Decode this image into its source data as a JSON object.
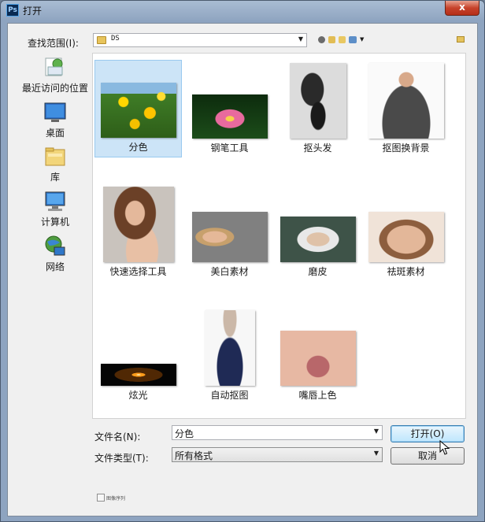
{
  "window": {
    "app_icon_text": "Ps",
    "title": "打开",
    "close_glyph": "x"
  },
  "lookin": {
    "label": "查找范围(I):",
    "value": "DS"
  },
  "places": [
    {
      "label": "最近访问的位置",
      "icon": "recent-places-icon"
    },
    {
      "label": "桌面",
      "icon": "desktop-icon"
    },
    {
      "label": "库",
      "icon": "libraries-icon"
    },
    {
      "label": "计算机",
      "icon": "computer-icon"
    },
    {
      "label": "网络",
      "icon": "network-icon"
    }
  ],
  "files": [
    {
      "name": "分色",
      "selected": true
    },
    {
      "name": "钢笔工具"
    },
    {
      "name": "抠头发"
    },
    {
      "name": "抠图换背景"
    },
    {
      "name": "快速选择工具"
    },
    {
      "name": "美白素材"
    },
    {
      "name": "磨皮"
    },
    {
      "name": "祛斑素材"
    },
    {
      "name": "炫光"
    },
    {
      "name": "自动抠图"
    },
    {
      "name": "嘴唇上色"
    }
  ],
  "filename": {
    "label": "文件名(N):",
    "value": "分色"
  },
  "filetype": {
    "label": "文件类型(T):",
    "value": "所有格式"
  },
  "buttons": {
    "open": "打开(O)",
    "cancel": "取消"
  },
  "preview_checkbox": {
    "label": "图像序列",
    "checked": false
  },
  "colors": {
    "selection": "#cce4f7",
    "default_button": "#bee6fd"
  }
}
